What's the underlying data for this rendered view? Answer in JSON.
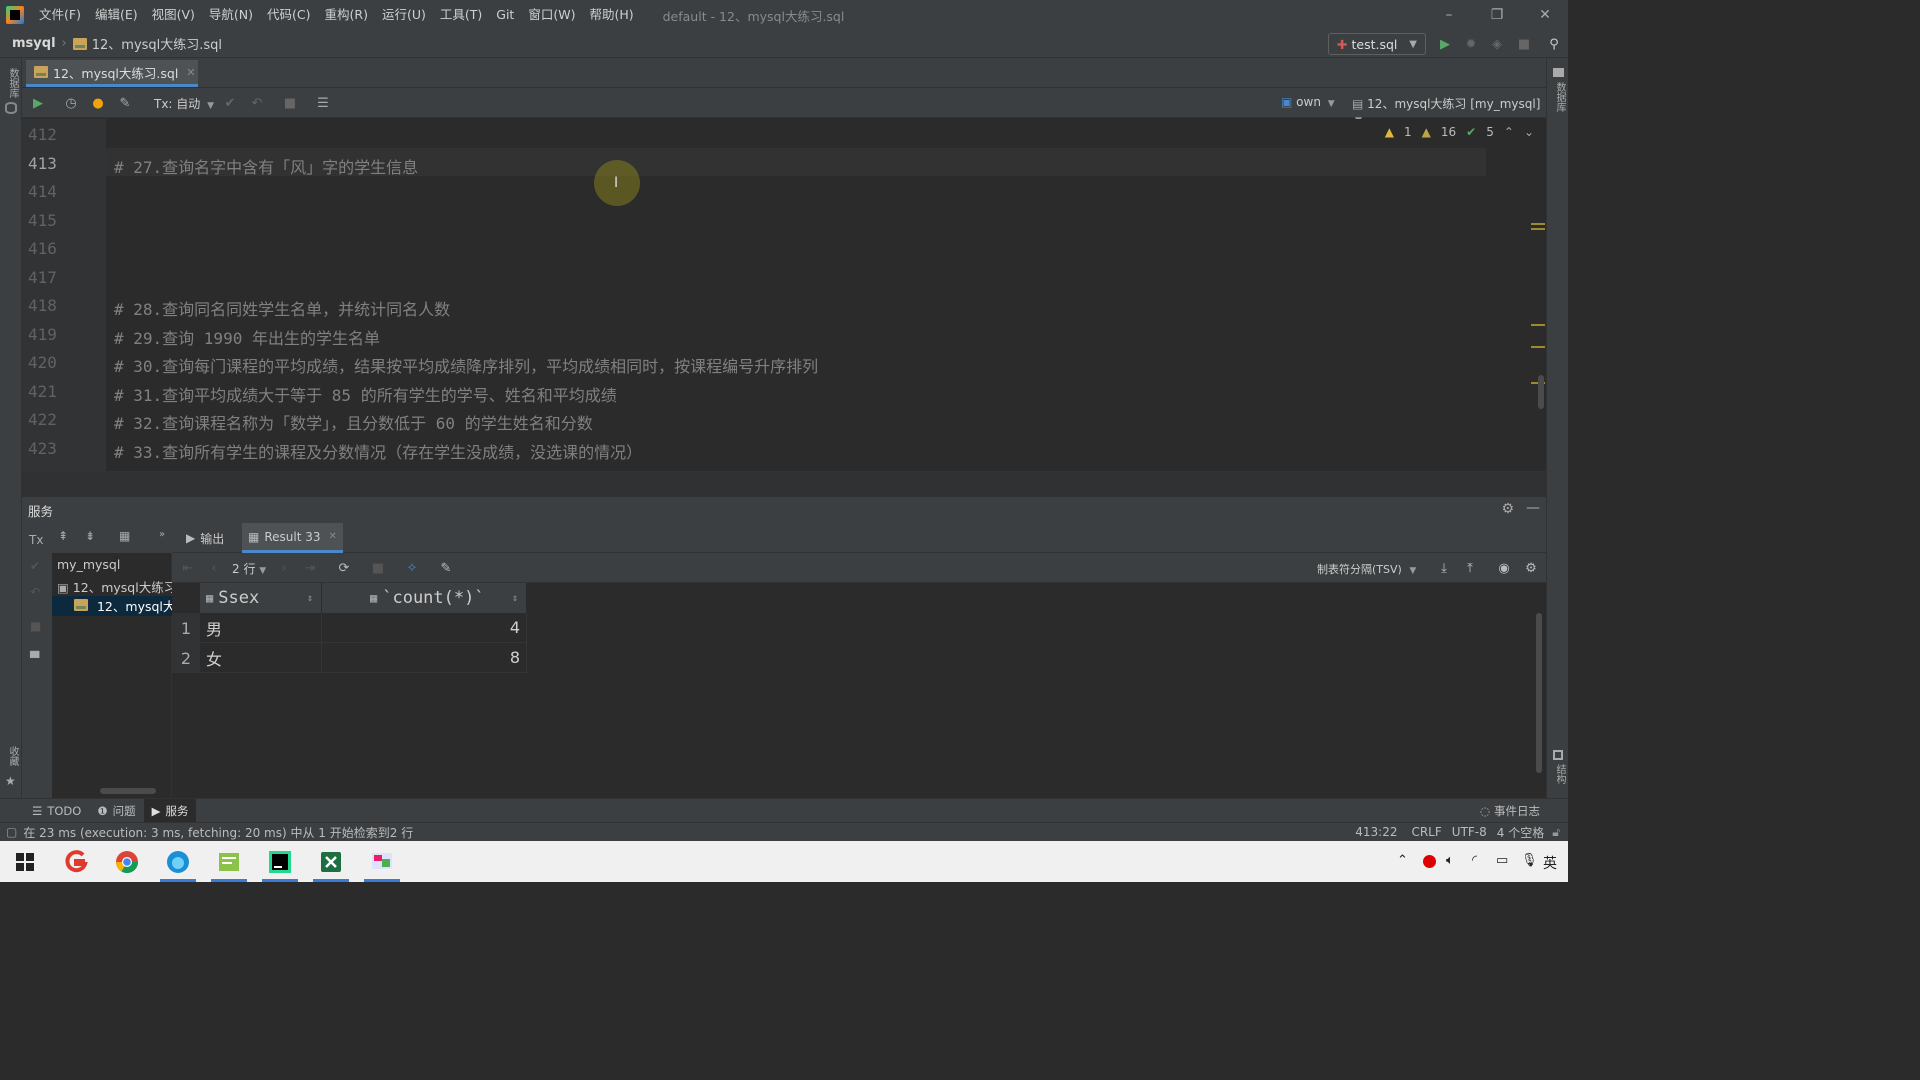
{
  "app": {
    "menu": [
      "文件(F)",
      "编辑(E)",
      "视图(V)",
      "导航(N)",
      "代码(C)",
      "重构(R)",
      "运行(U)",
      "工具(T)",
      "Git",
      "窗口(W)",
      "帮助(H)"
    ],
    "window_title": "default - 12、mysql大练习.sql",
    "window_controls": {
      "minimize": "–",
      "restore": "❐",
      "close": "✕"
    }
  },
  "navbar": {
    "project": "msyql",
    "file": "12、mysql大练习.sql",
    "run_config": "test.sql"
  },
  "left_strip": {
    "top_label": "数据库",
    "bottom_label": "收藏"
  },
  "right_strip": {
    "top_label": "数据库",
    "bottom_label": "结构"
  },
  "editor_tab": {
    "label": "12、mysql大练习.sql"
  },
  "editor_toolbar": {
    "tx_mode": "Tx: 自动",
    "schema": "own",
    "console": "12、mysql大练习 [my_mysql]"
  },
  "inspections": {
    "warnings": "1",
    "weak_warnings": "16",
    "ok": "5"
  },
  "editor": {
    "lines": [
      {
        "num": "412",
        "text": ""
      },
      {
        "num": "413",
        "text": "# 27.查询名字中含有「风」字的学生信息"
      },
      {
        "num": "414",
        "text": ""
      },
      {
        "num": "415",
        "text": ""
      },
      {
        "num": "416",
        "text": ""
      },
      {
        "num": "417",
        "text": ""
      },
      {
        "num": "418",
        "text": "# 28.查询同名同姓学生名单，并统计同名人数"
      },
      {
        "num": "419",
        "text": "# 29.查询 1990 年出生的学生名单"
      },
      {
        "num": "420",
        "text": "# 30.查询每门课程的平均成绩，结果按平均成绩降序排列，平均成绩相同时，按课程编号升序排列"
      },
      {
        "num": "421",
        "text": "# 31.查询平均成绩大于等于 85 的所有学生的学号、姓名和平均成绩"
      },
      {
        "num": "422",
        "text": "# 32.查询课程名称为「数学」，且分数低于 60 的学生姓名和分数"
      },
      {
        "num": "423",
        "text": "# 33.查询所有学生的课程及分数情况（存在学生没成绩，没选课的情况）"
      }
    ]
  },
  "services": {
    "title": "服务",
    "tree": {
      "root": "my_mysql",
      "session": "12、mysql大练习",
      "console": "12、mysql大练"
    },
    "tabs": [
      {
        "label": "输出"
      },
      {
        "label": "Result 33"
      }
    ],
    "grid_toolbar": {
      "rows_label": "2 行",
      "export_format": "制表符分隔(TSV)"
    },
    "grid": {
      "columns": [
        "Ssex",
        "`count(*)`"
      ],
      "rows": [
        {
          "num": "1",
          "cells": [
            "男",
            "4"
          ]
        },
        {
          "num": "2",
          "cells": [
            "女",
            "8"
          ]
        }
      ]
    }
  },
  "tool_tabs": [
    {
      "label": "TODO"
    },
    {
      "label": "问题"
    },
    {
      "label": "服务"
    }
  ],
  "event_log": "事件日志",
  "status": {
    "message": "在 23 ms (execution: 3 ms, fetching: 20 ms) 中从 1 开始检索到2 行",
    "position": "413:22",
    "line_sep": "CRLF",
    "encoding": "UTF-8",
    "indent": "4 个空格"
  },
  "taskbar": {
    "tray_lang": "英"
  }
}
